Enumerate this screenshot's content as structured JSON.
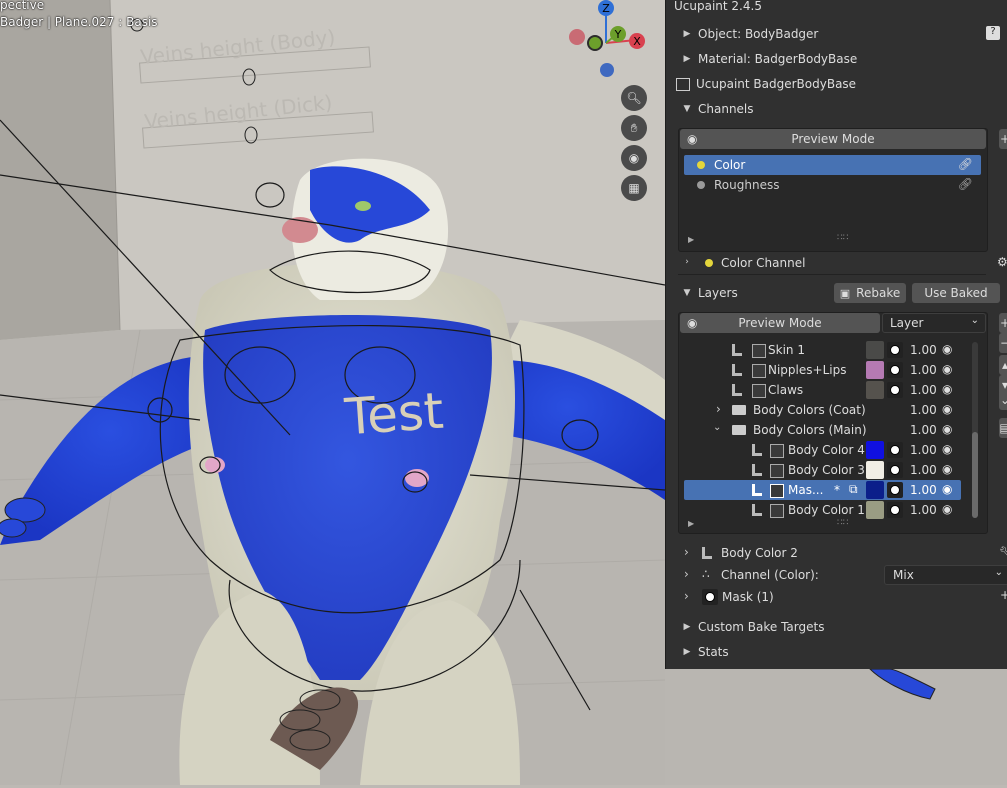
{
  "viewport": {
    "view_mode": "pective",
    "object_info": "Badger | Plane.027 : Basis",
    "sign_1": "Veins height (Body)",
    "sign_2": "Veins height (Dick)",
    "body_text": "Test",
    "gizmo": {
      "x": "X",
      "y": "Y",
      "z": "Z"
    },
    "tools": [
      "zoom-icon",
      "hand-pan-icon",
      "camera-icon",
      "grid-icon"
    ]
  },
  "panel": {
    "title": "Ucupaint 2.4.5",
    "object_label": "Object: BodyBadger",
    "material_label": "Material: BadgerBodyBase",
    "node_label": "Ucupaint BadgerBodyBase",
    "channels_header": "Channels",
    "channels_preview_btn": "Preview Mode",
    "channels": [
      {
        "name": "Color",
        "selected": true,
        "dot": "#e4d63c"
      },
      {
        "name": "Roughness",
        "selected": false,
        "dot": "#9a9a9a"
      }
    ],
    "color_channel_label": "Color Channel",
    "layers_header": "Layers",
    "rebake_btn": "Rebake",
    "use_baked_btn": "Use Baked",
    "layers_preview_btn": "Preview Mode",
    "layers_mode_select": "Layer",
    "layers": [
      {
        "name": "Skin 1",
        "color": "#4a4a48",
        "value": "1.00",
        "mask": true
      },
      {
        "name": "Nipples+Lips",
        "color": "#b57ab3",
        "value": "1.00",
        "mask": true
      },
      {
        "name": "Claws",
        "color": "#55524d",
        "value": "1.00",
        "mask": true
      },
      {
        "name": "Body Colors (Coat)",
        "value": "1.00",
        "folder": true,
        "expanded": false
      },
      {
        "name": "Body Colors (Main)",
        "value": "1.00",
        "folder": true,
        "expanded": true
      },
      {
        "name": "Body Color 4",
        "color": "#1010e0",
        "value": "1.00",
        "mask": true
      },
      {
        "name": "Body Color 3",
        "color": "#f2efe6",
        "value": "1.00",
        "mask": true
      },
      {
        "name": "Mas...",
        "color": "#0b1f8a",
        "value": "1.00",
        "mask": true,
        "selected": true,
        "modified": "*"
      },
      {
        "name": "Body Color 1",
        "color": "#9a9c83",
        "value": "1.00",
        "mask": true
      }
    ],
    "body_color_2_label": "Body Color 2",
    "channel_color_label": "Channel (Color):",
    "channel_blend": "Mix",
    "mask_label": "Mask (1)",
    "custom_bake_label": "Custom Bake Targets",
    "stats_label": "Stats"
  },
  "colors": {
    "panel_bg": "#303030",
    "selection": "#4772b3",
    "axis_x": "#d9414f",
    "axis_y": "#6c9f2b",
    "axis_z": "#2e6fd6"
  }
}
